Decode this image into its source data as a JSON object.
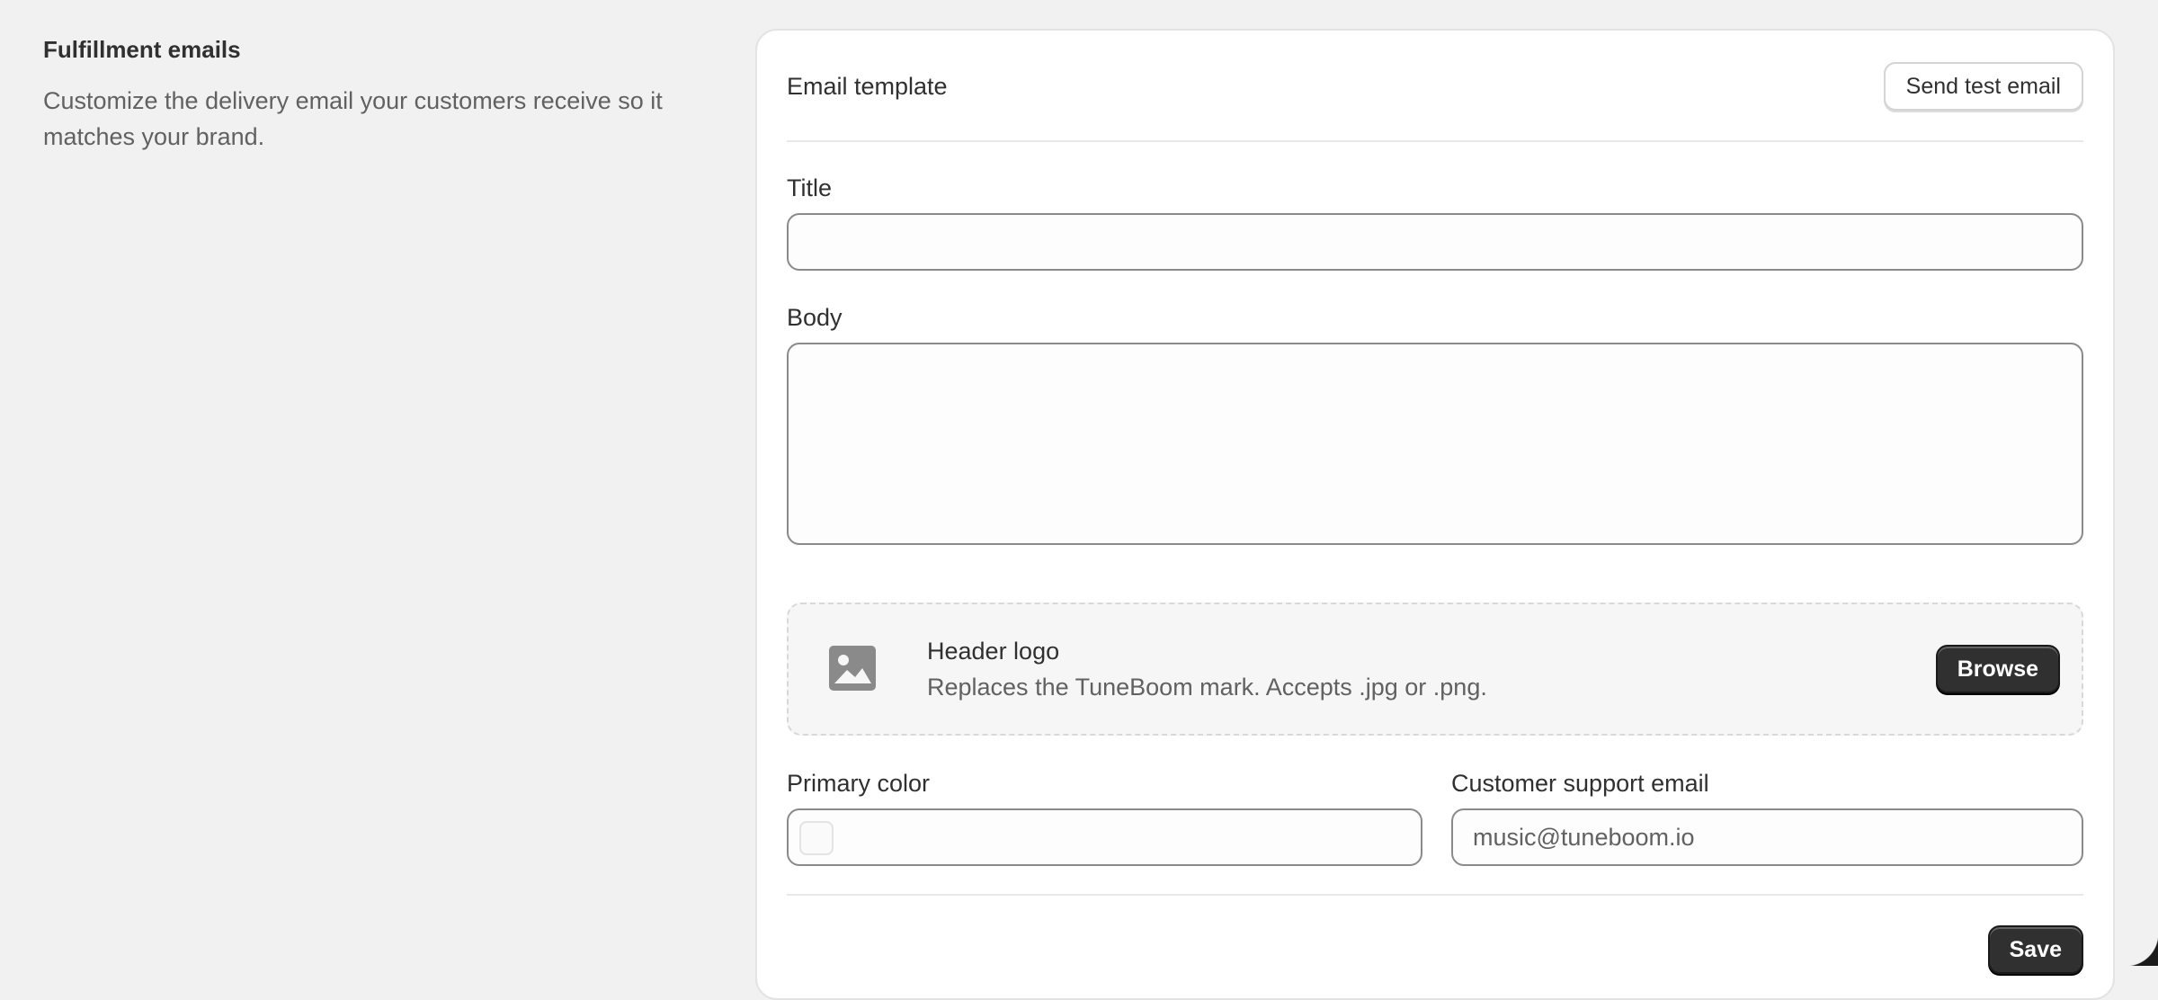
{
  "section": {
    "title": "Fulfillment emails",
    "description": "Customize the delivery email your customers receive so it matches your brand."
  },
  "card": {
    "title": "Email template",
    "send_test_label": "Send test email"
  },
  "fields": {
    "title_label": "Title",
    "title_value": "",
    "body_label": "Body",
    "body_value": "",
    "primary_color_label": "Primary color",
    "primary_color_value": "",
    "support_email_label": "Customer support email",
    "support_email_value": "music@tuneboom.io"
  },
  "logo_upload": {
    "icon": "image-icon",
    "title": "Header logo",
    "subtitle": "Replaces the TuneBoom mark. Accepts .jpg or .png.",
    "browse_label": "Browse"
  },
  "footer": {
    "save_label": "Save"
  },
  "colors": {
    "background": "#f1f1f1",
    "primary_button": "#303030",
    "card": "#ffffff"
  }
}
